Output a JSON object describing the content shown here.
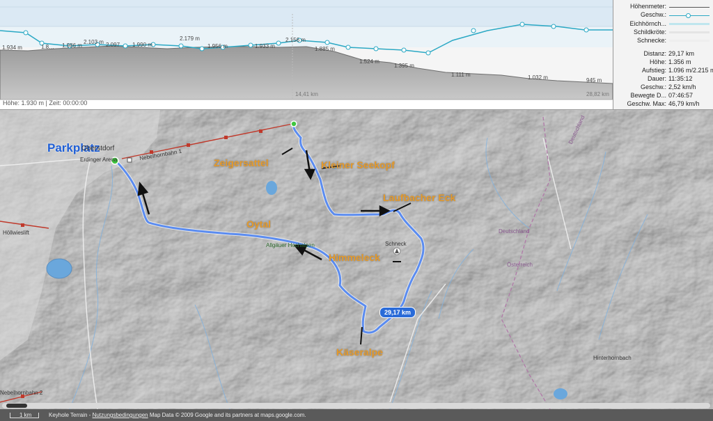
{
  "profile": {
    "status": "Höhe: 1.930 m | Zeit: 00:00:00",
    "distance_marks": [
      "14,41 km",
      "28,82 km"
    ],
    "elevation_labels": [
      "1.934 m",
      "1.8…",
      "1.986 m",
      "2.103 m",
      "2.097",
      "1.990 m",
      "2.179 m",
      "1.956 m",
      "1.933 m",
      "2.156 m",
      "1.885 m",
      "1.524 m",
      "1.395 m",
      "1.111 m",
      "1.032 m",
      "945 m"
    ]
  },
  "legend": {
    "items": [
      {
        "label": "Höhenmeter:",
        "color": "#555555"
      },
      {
        "label": "Geschw.:",
        "color": "#2aa8c4"
      },
      {
        "label": "Eichhörnch...",
        "color": "#bfe6ee"
      },
      {
        "label": "Schildkröte:",
        "color": "#e4e4e4"
      },
      {
        "label": "Schnecke:",
        "color": "#eeeeee"
      }
    ]
  },
  "stats": [
    {
      "label": "Distanz:",
      "value": "29,17 km"
    },
    {
      "label": "Höhe:",
      "value": "1.356 m"
    },
    {
      "label": "Aufstieg:",
      "value": "1.096 m/2.215 m"
    },
    {
      "label": "Dauer:",
      "value": "11:35:12"
    },
    {
      "label": "Geschw.:",
      "value": "2,52 km/h"
    },
    {
      "label": "Bewegte D...",
      "value": "07:46:57"
    },
    {
      "label": "Geschw. Max:",
      "value": "46,79 km/h"
    }
  ],
  "map": {
    "parkplatz": "Parkplatz",
    "waypoints": [
      "Zeigersattel",
      "Kleiner Seekopf",
      "Laufbacher Eck",
      "Oytal",
      "Himmeleck",
      "Käseralpe"
    ],
    "distance_badge": "29,17 km",
    "places": {
      "oberstdorf": "Oberstdorf",
      "erdinger": "Erdinger Arena",
      "nebelhornbahn": "Nebelhornbahn 1",
      "hochalpen": "Allgäuer Hochalpen",
      "schneck": "Schneck",
      "hinterhornbach": "Hinterhornbach",
      "deutschland1": "Deutschland",
      "deutschland2": "Deutschland",
      "oesterreich": "Österreich",
      "hoellwieslift": "Höllwieslift",
      "nebelhornbahn2": "Nebelhornbahn 2"
    }
  },
  "footer": {
    "scale": "1 km",
    "attribution_prefix": "Keyhole Terrain - ",
    "terms": "Nutzungsbedingungen",
    "attribution_suffix": " Map Data © 2009 Google and its partners at maps.google.com."
  }
}
